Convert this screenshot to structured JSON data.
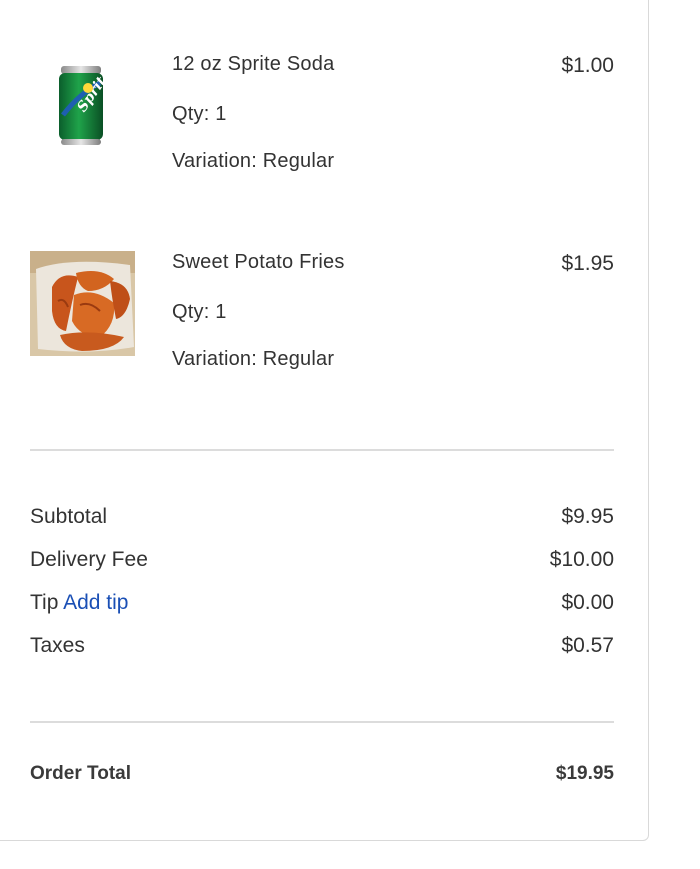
{
  "items": [
    {
      "name": "12 oz Sprite Soda",
      "qty": "Qty: 1",
      "variation": "Variation: Regular",
      "price": "$1.00",
      "thumb_icon": "sprite-can-icon"
    },
    {
      "name": "Sweet Potato Fries",
      "qty": "Qty: 1",
      "variation": "Variation: Regular",
      "price": "$1.95",
      "thumb_icon": "sweet-potato-fries-photo"
    }
  ],
  "summary": {
    "subtotal_label": "Subtotal",
    "subtotal_value": "$9.95",
    "delivery_label": "Delivery Fee",
    "delivery_value": "$10.00",
    "tip_label": "Tip",
    "add_tip_label": "Add tip",
    "tip_value": "$0.00",
    "taxes_label": "Taxes",
    "taxes_value": "$0.57"
  },
  "total": {
    "label": "Order Total",
    "value": "$19.95"
  },
  "colors": {
    "link": "#1a4fb5",
    "text": "#333333",
    "divider": "#dcdcdc"
  }
}
